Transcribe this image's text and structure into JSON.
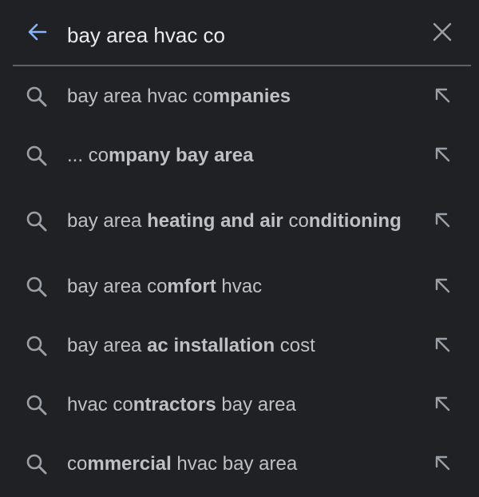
{
  "search": {
    "query": "bay area hvac co"
  },
  "icons": {
    "back": "arrow-left-icon",
    "clear": "close-icon",
    "suggestion": "search-icon",
    "fill": "arrow-up-left-icon"
  },
  "colors": {
    "background": "#202124",
    "accent": "#8ab4f8",
    "text": "#bdc1c6",
    "icon": "#9aa0a6"
  },
  "suggestions": [
    {
      "segments": [
        {
          "text": "bay area hvac co",
          "bold": false
        },
        {
          "text": "mpanies",
          "bold": true
        }
      ]
    },
    {
      "segments": [
        {
          "text": "... co",
          "bold": false
        },
        {
          "text": "mpany bay area",
          "bold": true
        }
      ]
    },
    {
      "segments": [
        {
          "text": "bay area ",
          "bold": false
        },
        {
          "text": "heating and air",
          "bold": true
        },
        {
          "text": " co",
          "bold": false
        },
        {
          "text": "nditioning",
          "bold": true
        }
      ]
    },
    {
      "segments": [
        {
          "text": "bay area co",
          "bold": false
        },
        {
          "text": "mfort",
          "bold": true
        },
        {
          "text": " hvac",
          "bold": false
        }
      ]
    },
    {
      "segments": [
        {
          "text": "bay area ",
          "bold": false
        },
        {
          "text": "ac installation",
          "bold": true
        },
        {
          "text": " cost",
          "bold": false
        }
      ]
    },
    {
      "segments": [
        {
          "text": "hvac co",
          "bold": false
        },
        {
          "text": "ntractors",
          "bold": true
        },
        {
          "text": " bay area",
          "bold": false
        }
      ]
    },
    {
      "segments": [
        {
          "text": "co",
          "bold": false
        },
        {
          "text": "mmercial",
          "bold": true
        },
        {
          "text": " hvac bay area",
          "bold": false
        }
      ]
    }
  ]
}
